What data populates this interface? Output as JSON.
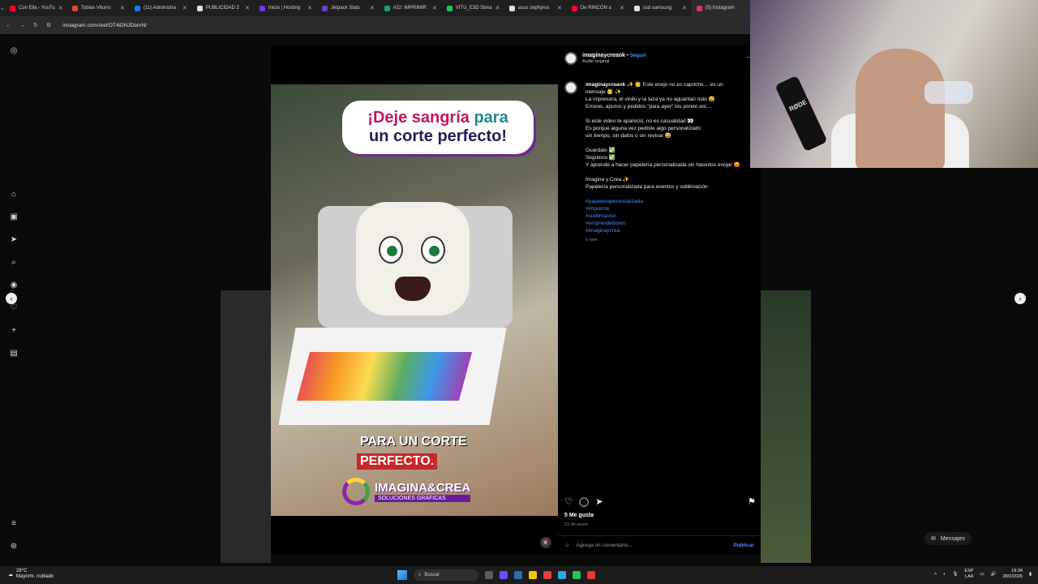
{
  "browser": {
    "tabs": [
      {
        "label": "Con Ella - YouTu",
        "color": "#ff0033"
      },
      {
        "label": "Tobias Viturro",
        "color": "#ea4335"
      },
      {
        "label": "(11) Administra",
        "color": "#1877f2"
      },
      {
        "label": "PUBLICIDAD 2",
        "color": "#e0e0e0"
      },
      {
        "label": "Inicio | Hosting",
        "color": "#7b2ff7"
      },
      {
        "label": "Jetpack Stats",
        "color": "#6a3cc9"
      },
      {
        "label": "#22: IMPRIMIR",
        "color": "#22a06b"
      },
      {
        "label": "VITU_E3D Strea",
        "color": "#22c55e"
      },
      {
        "label": "asus zephyrus",
        "color": "#e0e0e0"
      },
      {
        "label": "De RINCÓN a",
        "color": "#ff0033"
      },
      {
        "label": "ssd samsung",
        "color": "#e0e0e0"
      },
      {
        "label": "(5) Instagram",
        "color": "#e1306c"
      }
    ],
    "url": "instagram.com/reel/DT4iDNJDamN/"
  },
  "video": {
    "bubble_line1_a": "¡Deje sangría",
    "bubble_line1_b": "para",
    "bubble_line2": "un corte perfecto!",
    "caption_line1": "PARA UN CORTE",
    "caption_line2": "PERFECTO.",
    "logo_name": "IMAGINA&CREA",
    "logo_sub": "SOLUCIONES GRÁFICAS"
  },
  "post": {
    "username": "imaginaycreaok",
    "follow": "Seguir",
    "audio": "Audio original",
    "caption_lines": [
      "✨ 👶 Este enojo no es capricho… es un",
      "mensaje 👶 ✨",
      "La impresora, el vinilo y la taza ya no aguantan más 😩",
      "Errores, apuros y pedidos \"para ayer\" los ponen así…",
      "",
      "Si este video te apareció, no es casualidad 👀",
      "Es porque alguna vez pediste algo personalizado",
      "sin tiempo, sin datos o sin revisar 😅",
      "",
      "Guardalo ✅",
      "Seguinos ✅",
      "Y aprendé a hacer papelería personalizada sin hacerlos enojar 😡",
      "",
      "Imagina y Crea ✨",
      "Papelería personalizada para eventos y sublimación",
      ""
    ],
    "hashtags": [
      "#papeleriapersonalizada",
      "#imprenta",
      "#sublimacion",
      "#emprendedores",
      "#imaginaycrea"
    ],
    "time_ago": "5 sem",
    "likes": "5 Me gusta",
    "date": "23 de enero",
    "comment_placeholder": "Agrega un comentario...",
    "publish": "Publicar"
  },
  "webcam": {
    "mic_brand": "RØDE"
  },
  "messages": {
    "label": "Mensajes"
  },
  "taskbar": {
    "temp": "28°C",
    "weather": "Mayorm. nublado",
    "search": "Buscar",
    "lang1": "ESP",
    "lang2": "LAA",
    "time": "19:34",
    "date": "28/2/2026"
  }
}
